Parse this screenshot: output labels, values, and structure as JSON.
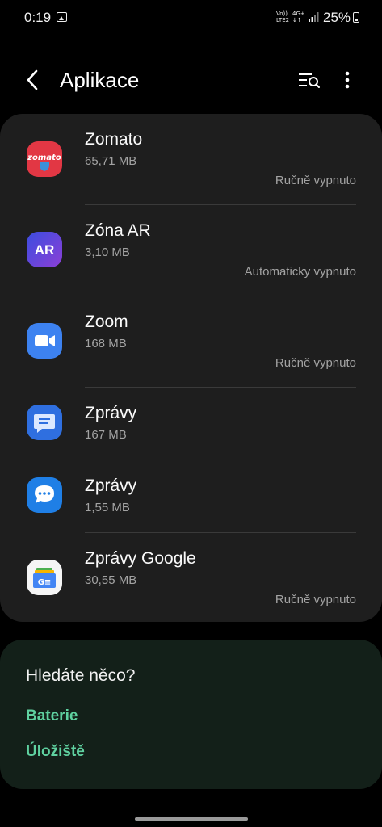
{
  "status": {
    "time": "0:19",
    "net1_top": "Vo))",
    "net1_bottom": "LTE2",
    "net2_top": "4G+",
    "net2_bottom": "↓↑",
    "battery": "25%"
  },
  "header": {
    "title": "Aplikace"
  },
  "apps": [
    {
      "name": "Zomato",
      "size": "65,71 MB",
      "status": "Ručně vypnuto",
      "icon": "zomato-icon"
    },
    {
      "name": "Zóna AR",
      "size": "3,10 MB",
      "status": "Automaticky vypnuto",
      "icon": "ar-zone-icon",
      "icon_text": "AR"
    },
    {
      "name": "Zoom",
      "size": "168 MB",
      "status": "Ručně vypnuto",
      "icon": "zoom-icon"
    },
    {
      "name": "Zprávy",
      "size": "167 MB",
      "status": "",
      "icon": "messages-icon"
    },
    {
      "name": "Zprávy",
      "size": "1,55 MB",
      "status": "",
      "icon": "samsung-messages-icon"
    },
    {
      "name": "Zprávy Google",
      "size": "30,55 MB",
      "status": "Ručně vypnuto",
      "icon": "google-news-icon"
    }
  ],
  "zomato_logo_text": "zomato",
  "google_news_badge": "G≡",
  "suggestions": {
    "title": "Hledáte něco?",
    "links": [
      "Baterie",
      "Úložiště"
    ]
  },
  "colors": {
    "accent_green": "#5fd1a0",
    "card_bg": "#1e1e1e",
    "suggest_bg": "#132019"
  }
}
